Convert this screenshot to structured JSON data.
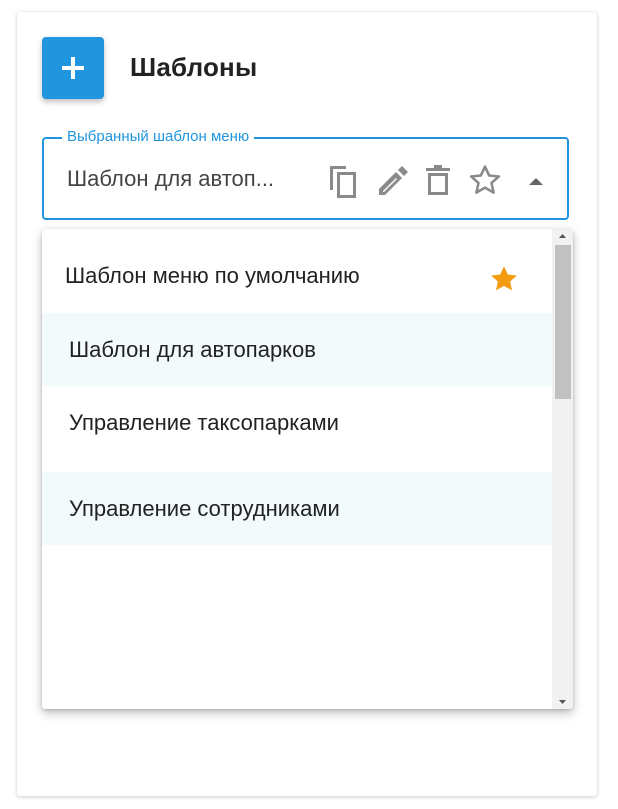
{
  "header": {
    "title": "Шаблоны",
    "add_button_icon": "plus-icon"
  },
  "select": {
    "legend": "Выбранный шаблон меню",
    "value": "Шаблон для автоп...",
    "icons": [
      "copy-icon",
      "edit-icon",
      "delete-icon",
      "star-outline-icon",
      "caret-up-icon"
    ]
  },
  "dropdown": {
    "options": [
      {
        "label": "Шаблон меню по умолчанию",
        "favorite": true
      },
      {
        "label": "Шаблон для автопарков",
        "favorite": false
      },
      {
        "label": "Управление таксопарками",
        "favorite": false
      },
      {
        "label": "Управление сотрудниками",
        "favorite": false
      }
    ]
  },
  "colors": {
    "accent": "#2196de",
    "star": "#f39c12",
    "row_alt": "#f3fafc"
  }
}
